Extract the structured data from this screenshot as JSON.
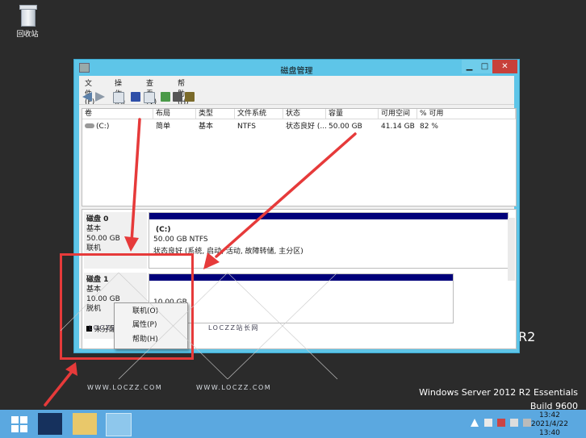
{
  "desktop": {
    "recycle_bin": "回收站",
    "branding_line1": "Windows Server 2012 R2 Essentials",
    "branding_line2": "Build 9600",
    "r2_fragment": "R2",
    "watermarks": [
      "LOCZZ站长网",
      "LOCZZ站长网",
      "WWW.LOCZZ.COM",
      "WWW.LOCZZ.COM"
    ]
  },
  "window": {
    "title": "磁盘管理",
    "minimize": "▁",
    "maximize": "□",
    "close": "✕",
    "menu": [
      "文件(F)",
      "操作(A)",
      "查看(V)",
      "帮助(H)"
    ]
  },
  "volume_list": {
    "columns": [
      "卷",
      "布局",
      "类型",
      "文件系统",
      "状态",
      "容量",
      "可用空间",
      "% 可用"
    ],
    "rows": [
      {
        "name": "(C:)",
        "layout": "简单",
        "type": "基本",
        "fs": "NTFS",
        "status": "状态良好 (...",
        "capacity": "50.00 GB",
        "free": "41.14 GB",
        "pct": "82 %"
      }
    ]
  },
  "disks": [
    {
      "name": "磁盘 0",
      "type": "基本",
      "size": "50.00 GB",
      "state": "联机",
      "volume": {
        "label": "(C:)",
        "detail": "50.00 GB NTFS",
        "status": "状态良好 (系统, 启动, 活动, 故障转储, 主分区)"
      }
    },
    {
      "name": "磁盘 1",
      "type": "基本",
      "size": "10.00 GB",
      "state": "脱机",
      "volume": {
        "detail": "10.00 GB"
      }
    }
  ],
  "unallocated": "未分配",
  "context_menu": [
    "联机(O)",
    "属性(P)",
    "帮助(H)"
  ],
  "taskbar": {
    "clock_time": "13:42",
    "clock_date": "2021/4/22",
    "clock_time2": "13:40"
  },
  "colors": {
    "window_frame": "#5ec5e8",
    "volume_bar": "#00007a",
    "annotation_red": "#e63a3a",
    "taskbar": "#5ba8e0"
  }
}
